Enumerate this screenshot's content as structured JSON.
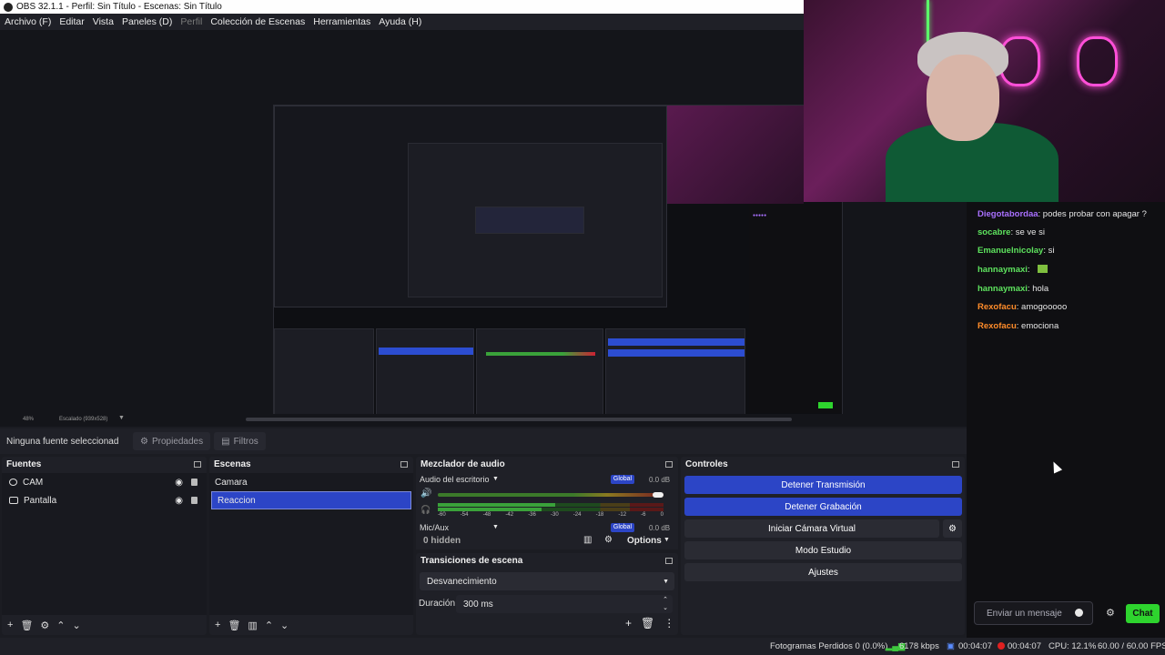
{
  "window": {
    "title": "OBS 32.1.1 - Perfil: Sin Título - Escenas: Sin Título"
  },
  "menu": [
    {
      "label": "Archivo (F)",
      "enabled": true
    },
    {
      "label": "Editar",
      "enabled": true
    },
    {
      "label": "Vista",
      "enabled": true
    },
    {
      "label": "Paneles (D)",
      "enabled": true
    },
    {
      "label": "Perfil",
      "enabled": false
    },
    {
      "label": "Colección de Escenas",
      "enabled": true
    },
    {
      "label": "Herramientas",
      "enabled": true
    },
    {
      "label": "Ayuda (H)",
      "enabled": true
    }
  ],
  "zoombar": {
    "zoom": "48%",
    "scale_label": "Escalado (939x528)"
  },
  "properties_bar": {
    "no_selection": "Ninguna fuente seleccionad",
    "properties_label": "Propiedades",
    "filters_label": "Filtros"
  },
  "sources": {
    "title": "Fuentes",
    "items": [
      {
        "label": "CAM",
        "icon": "camera-icon"
      },
      {
        "label": "Pantalla",
        "icon": "monitor-icon"
      }
    ]
  },
  "scenes": {
    "title": "Escenas",
    "items": [
      {
        "label": "Camara",
        "selected": false
      },
      {
        "label": "Reaccion",
        "selected": true
      }
    ]
  },
  "mixer": {
    "title": "Mezclador de audio",
    "channels": [
      {
        "name": "Audio del escritorio",
        "global": "Global",
        "db": "0.0 dB",
        "ticks": [
          "-60",
          "-54",
          "-48",
          "-42",
          "-36",
          "-30",
          "-24",
          "-18",
          "-12",
          "-6",
          "0"
        ]
      },
      {
        "name": "Mic/Aux",
        "global": "Global",
        "db": "0.0 dB"
      }
    ],
    "hidden_label": "0 hidden",
    "options_label": "Options"
  },
  "transitions": {
    "title": "Transiciones de escena",
    "selected": "Desvanecimiento",
    "duration_label": "Duración",
    "duration_value": "300 ms"
  },
  "controls": {
    "title": "Controles",
    "buttons": [
      {
        "label": "Detener Transmisión",
        "active": true
      },
      {
        "label": "Detener Grabación",
        "active": true
      },
      {
        "label": "Iniciar Cámara Virtual",
        "active": false
      },
      {
        "label": "Modo Estudio",
        "active": false
      },
      {
        "label": "Ajustes",
        "active": false
      }
    ]
  },
  "chat": {
    "messages": [
      {
        "user": "Diegotabordaa",
        "text": "podes probar con apagar ?",
        "color": "#a970ff"
      },
      {
        "user": "socabre",
        "text": "se ve si",
        "color": "#5ee35e"
      },
      {
        "user": "Emanuelnicolay",
        "text": "si",
        "color": "#5ee35e"
      },
      {
        "user": "hannaymaxi",
        "text": "",
        "color": "#5ee35e",
        "emote": true
      },
      {
        "user": "hannaymaxi",
        "text": "hola",
        "color": "#5ee35e"
      },
      {
        "user": "Rexofacu",
        "text": "amogooooo",
        "color": "#ff8c2a"
      },
      {
        "user": "Rexofacu",
        "text": "emociona",
        "color": "#ff8c2a"
      }
    ],
    "input_placeholder": "Enviar un mensaje",
    "send_label": "Chat"
  },
  "status": {
    "dropped_frames": "Fotogramas Perdidos 0 (0.0%)",
    "bitrate": "6178 kbps",
    "stream_time": "00:04:07",
    "rec_time": "00:04:07",
    "cpu": "CPU: 12.1%",
    "fps": "60.00 / 60.00 FPS"
  }
}
